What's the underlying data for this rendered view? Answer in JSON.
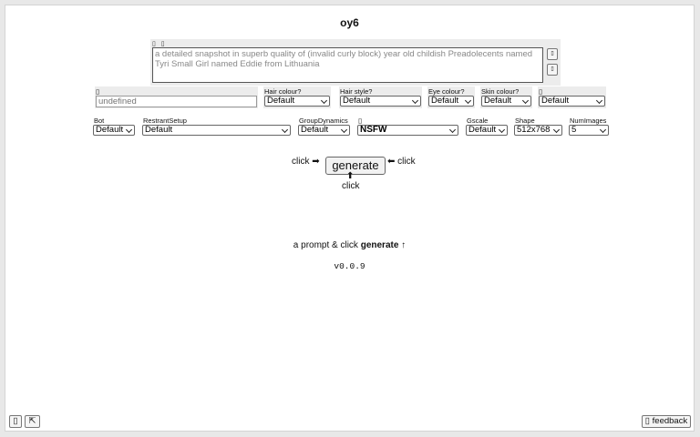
{
  "app": {
    "title": "oy6"
  },
  "prompt": {
    "icons": "▯ ▯",
    "text": "a detailed snapshot in superb quality of (invalid curly block) year old childish Preadolecents named Tyri Small Girl named Eddie from Lithuania",
    "side_btn_1": "▯",
    "side_btn_2": "▯"
  },
  "row1": {
    "name_icon": "▯",
    "name_placeholder": "undefined",
    "hair_colour": {
      "label": "Hair colour?",
      "value": "Default"
    },
    "hair_style": {
      "label": "Hair style?",
      "value": "Default"
    },
    "eye_colour": {
      "label": "Eye colour?",
      "value": "Default"
    },
    "skin_colour": {
      "label": "Skin colour?",
      "value": "Default"
    },
    "extra": {
      "label": "▯",
      "value": "Default"
    }
  },
  "row2": {
    "bot": {
      "label": "Bot",
      "value": "Default"
    },
    "restraint": {
      "label": "RestrantSetup",
      "value": "Default"
    },
    "group": {
      "label": "GroupDynamics",
      "value": "Default"
    },
    "nsfw": {
      "label": "▯",
      "value": "NSFW"
    },
    "gscale": {
      "label": "Gscale",
      "value": "Default"
    },
    "shape": {
      "label": "Shape",
      "value": "512x768"
    },
    "numimages": {
      "label": "NumImages",
      "value": "5"
    }
  },
  "generate": {
    "left_hint": "click ➡",
    "right_hint": "⬅ click",
    "label": "generate",
    "below_arrow": "⬆",
    "below_hint": "click"
  },
  "status": {
    "prefix": "a prompt & click ",
    "bold": "generate",
    "suffix": " ↑"
  },
  "version": "v0.0.9",
  "footer": {
    "btn1": "▯",
    "btn2": "⇱",
    "feedback": "▯ feedback"
  }
}
